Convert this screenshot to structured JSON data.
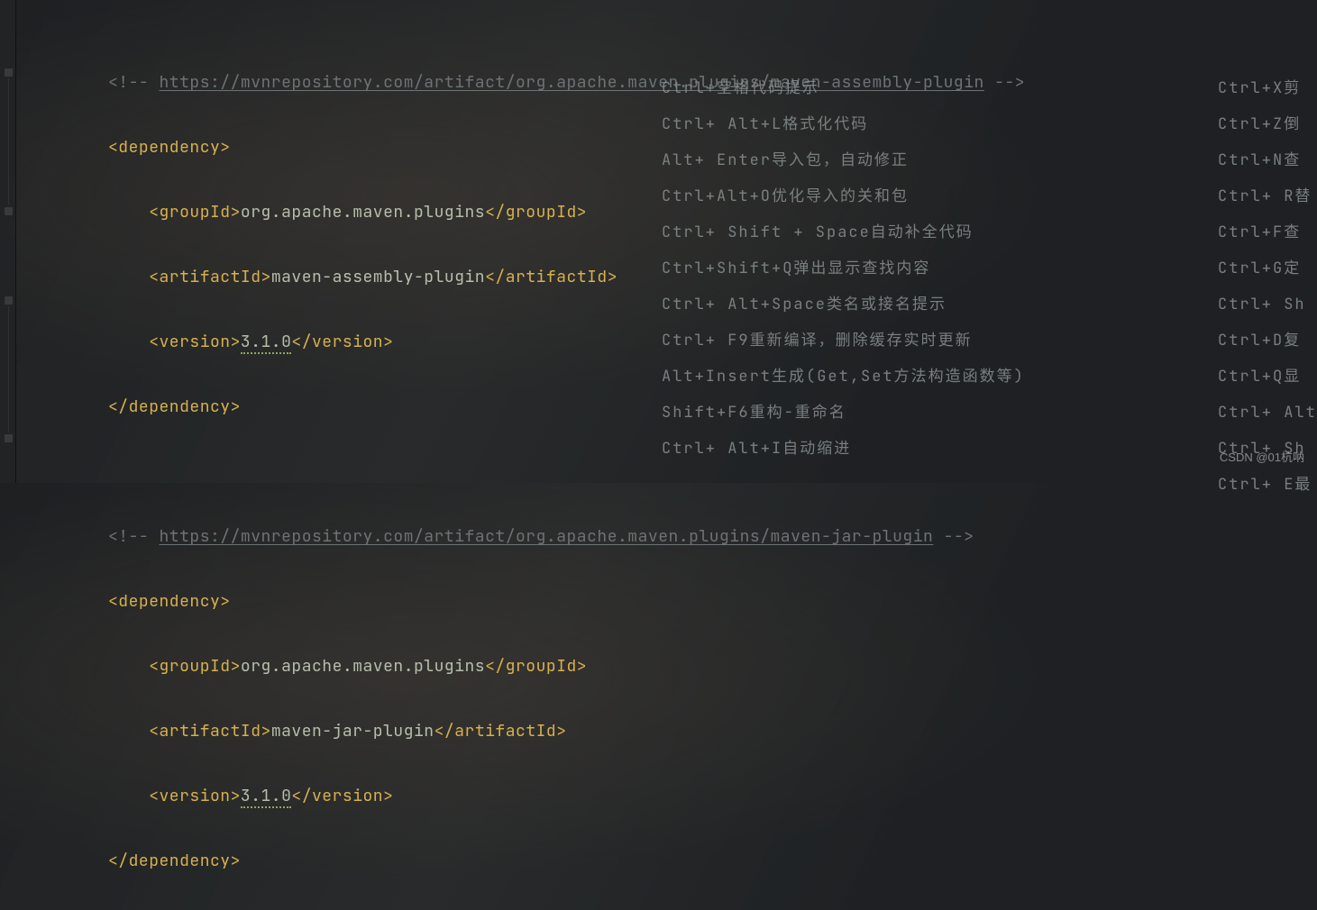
{
  "code": {
    "comment1_open": "<!-- ",
    "comment1_url": "https://mvnrepository.com/artifact/org.apache.maven.plugins/maven-assembly-plugin",
    "comment1_close": " -->",
    "dep_open": "<dependency>",
    "gid_open": "<groupId>",
    "gid_val": "org.apache.maven.plugins",
    "gid_close": "</groupId>",
    "aid_open": "<artifactId>",
    "aid1_val": "maven-assembly-plugin",
    "aid_close": "</artifactId>",
    "ver_open": "<version>",
    "ver_val": "3.1.0",
    "ver_close": "</version>",
    "dep_close": "</dependency>",
    "comment2_url": "https://mvnrepository.com/artifact/org.apache.maven.plugins/maven-jar-plugin",
    "aid2_val": "maven-jar-plugin"
  },
  "hints_left": [
    "Ctrl+空格代码提示",
    "Ctrl+ Alt+L格式化代码",
    "Alt+ Enter导入包，自动修正",
    "Ctrl+Alt+O优化导入的关和包",
    "Ctrl+ Shift + Space自动补全代码",
    "Ctrl+Shift+Q弹出显示查找内容",
    "Ctrl+ Alt+Space类名或接名提示",
    "Ctrl+ F9重新编译，删除缓存实时更新",
    "Alt+Insert生成(Get,Set方法构造函数等)",
    "",
    "Shift+F6重构-重命名",
    "Ctrl+ Alt+I自动缩进"
  ],
  "hints_right": [
    "Ctrl+X剪",
    "Ctrl+Z倒",
    "Ctrl+N查",
    "Ctrl+ R替",
    "Ctrl+F查",
    "Ctrl+G定",
    "Ctrl+ Sh",
    "Ctrl+D复",
    "Ctrl+Q显",
    "Ctrl+ Alt",
    "Ctrl+ Sh",
    "Ctrl+ E最"
  ],
  "watermark": "CSDN @01杭呐"
}
